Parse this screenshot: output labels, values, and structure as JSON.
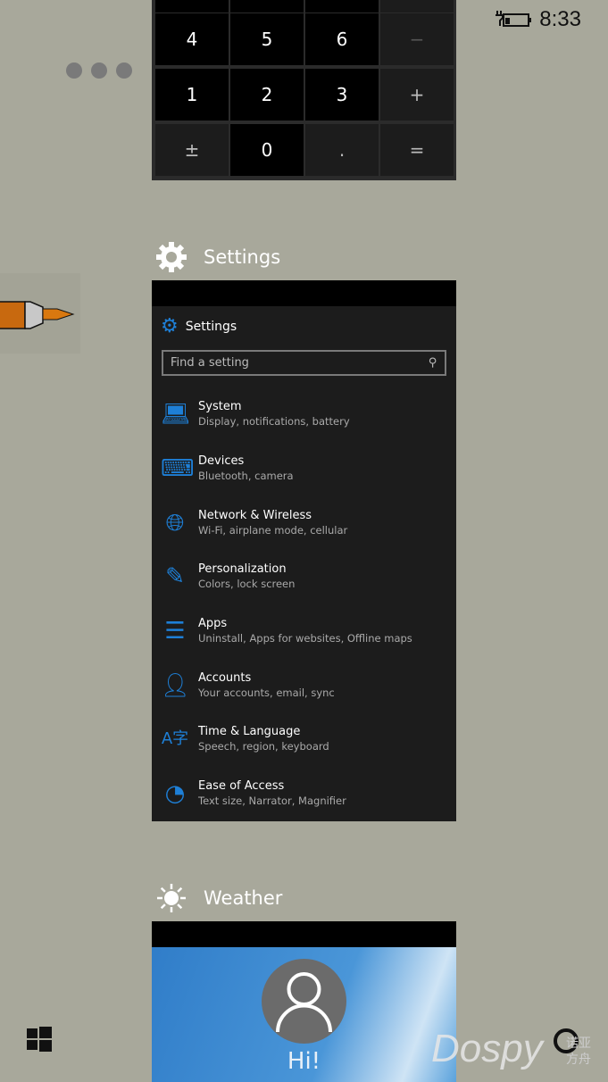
{
  "status": {
    "time": "8:33",
    "battery_icon": "battery-charging-icon"
  },
  "calculator": {
    "keys": [
      [
        "4",
        "5",
        "6",
        "−"
      ],
      [
        "1",
        "2",
        "3",
        "+"
      ],
      [
        "±",
        "0",
        ".",
        "="
      ]
    ]
  },
  "settings_app": {
    "label": "Settings",
    "inner_title": "Settings",
    "search_placeholder": "Find a setting",
    "items": [
      {
        "title": "System",
        "subtitle": "Display, notifications, battery",
        "icon": "laptop-icon"
      },
      {
        "title": "Devices",
        "subtitle": "Bluetooth, camera",
        "icon": "devices-icon"
      },
      {
        "title": "Network & Wireless",
        "subtitle": "Wi-Fi, airplane mode, cellular",
        "icon": "globe-icon"
      },
      {
        "title": "Personalization",
        "subtitle": "Colors, lock screen",
        "icon": "personalization-icon"
      },
      {
        "title": "Apps",
        "subtitle": "Uninstall, Apps for websites, Offline maps",
        "icon": "apps-list-icon"
      },
      {
        "title": "Accounts",
        "subtitle": "Your accounts, email, sync",
        "icon": "person-icon"
      },
      {
        "title": "Time & Language",
        "subtitle": "Speech, region, keyboard",
        "icon": "time-language-icon"
      },
      {
        "title": "Ease of Access",
        "subtitle": "Text size, Narrator, Magnifier",
        "icon": "ease-of-access-icon"
      }
    ]
  },
  "weather_app": {
    "label": "Weather",
    "greeting": "Hi!"
  },
  "watermark": "Dospy 诺亚方舟",
  "colors": {
    "background": "#a8a89b",
    "accent": "#1e7fd6"
  }
}
